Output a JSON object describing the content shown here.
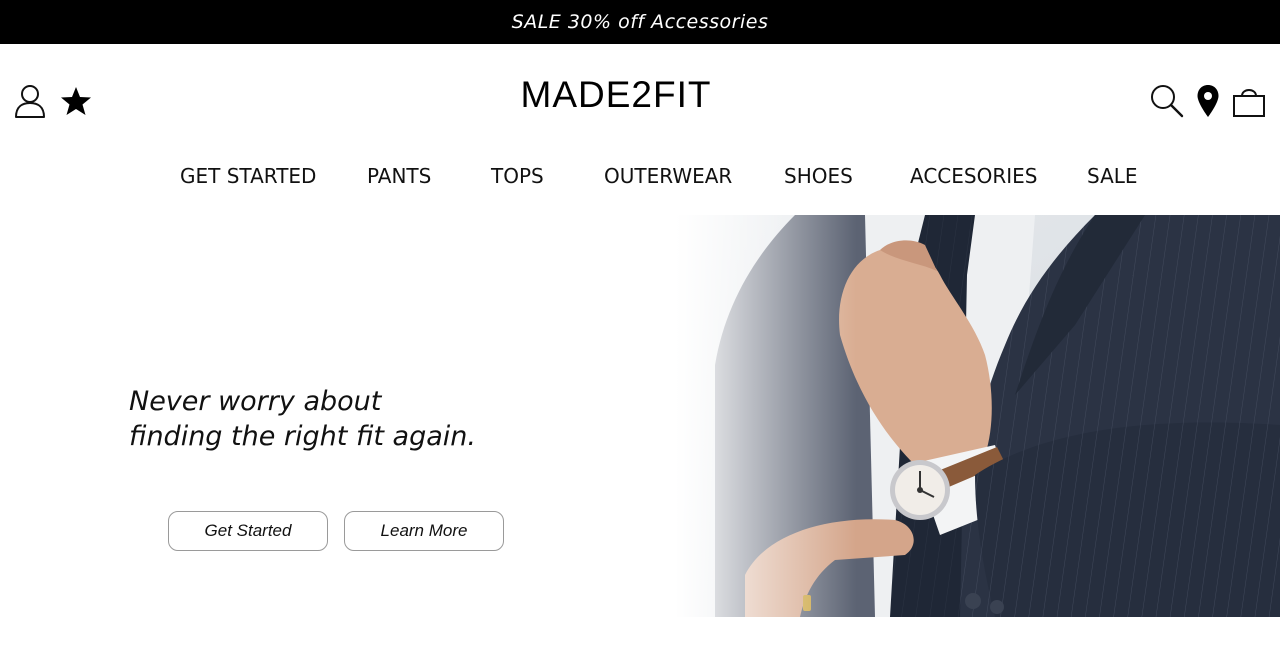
{
  "promo": {
    "text": "SALE 30% off Accessories"
  },
  "header": {
    "logo": "MADE2FIT",
    "left_icons": [
      "account-icon",
      "favorites-star-icon"
    ],
    "right_icons": [
      "search-icon",
      "store-locator-icon",
      "shopping-bag-icon"
    ]
  },
  "nav": {
    "items": [
      {
        "label": "GET STARTED"
      },
      {
        "label": "PANTS"
      },
      {
        "label": "TOPS"
      },
      {
        "label": "OUTERWEAR"
      },
      {
        "label": "SHOES"
      },
      {
        "label": "ACCESORIES"
      },
      {
        "label": "SALE"
      }
    ]
  },
  "hero": {
    "headline_line1": "Never worry about",
    "headline_line2": "finding the right fit again.",
    "primary_button": "Get Started",
    "secondary_button": "Learn More",
    "image": "man-in-suit-adjusting-tie-with-wristwatch"
  },
  "colors": {
    "promo_bg": "#000000",
    "promo_text": "#ffffff",
    "button_border": "#9a9a9a",
    "suit": "#2b3344"
  }
}
